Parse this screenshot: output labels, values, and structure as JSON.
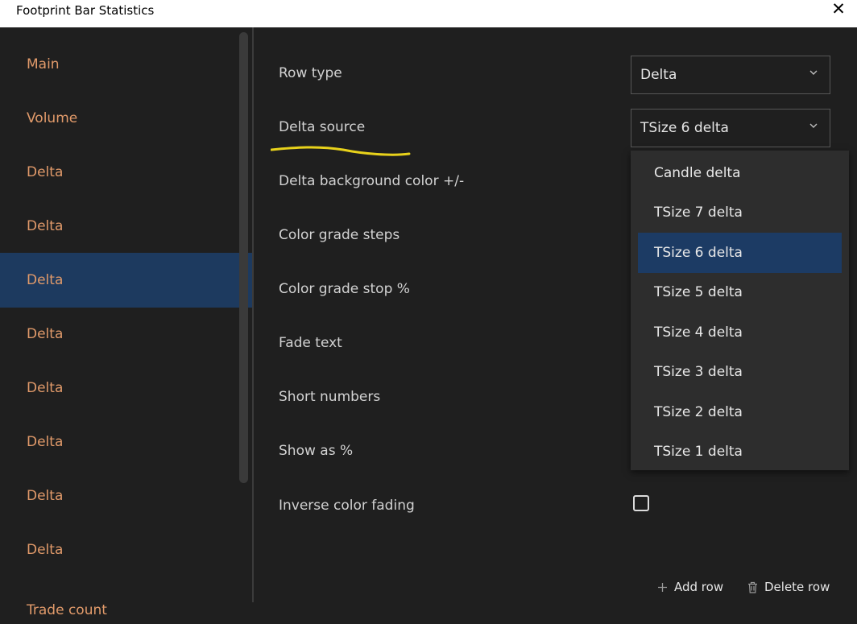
{
  "window": {
    "title": "Footprint Bar Statistics",
    "close_glyph": "✕"
  },
  "sidebar": {
    "items": [
      {
        "label": "Main"
      },
      {
        "label": "Volume"
      },
      {
        "label": "Delta"
      },
      {
        "label": "Delta"
      },
      {
        "label": "Delta",
        "active": true
      },
      {
        "label": "Delta"
      },
      {
        "label": "Delta"
      },
      {
        "label": "Delta"
      },
      {
        "label": "Delta"
      },
      {
        "label": "Delta"
      },
      {
        "label": "Trade count"
      }
    ]
  },
  "settings": {
    "rows": [
      {
        "label": "Row type"
      },
      {
        "label": "Delta source"
      },
      {
        "label": "Delta background color +/-"
      },
      {
        "label": "Color grade steps"
      },
      {
        "label": "Color grade stop %"
      },
      {
        "label": "Fade text"
      },
      {
        "label": "Short numbers"
      },
      {
        "label": "Show as %"
      },
      {
        "label": "Inverse color fading"
      }
    ],
    "row_type_value": "Delta",
    "delta_source_value": "TSize 6 delta",
    "inverse_color_fading_checked": false
  },
  "dropdown": {
    "options": [
      "Candle delta",
      "TSize 7 delta",
      "TSize 6 delta",
      "TSize 5 delta",
      "TSize 4 delta",
      "TSize 3 delta",
      "TSize 2 delta",
      "TSize 1 delta"
    ],
    "selected": "TSize 6 delta"
  },
  "footer": {
    "add_row": "Add row",
    "delete_row": "Delete row"
  },
  "colors": {
    "accent_text": "#e19a6a",
    "selection_bg": "#1d3a5f",
    "highlight_stroke": "#e8d21b",
    "background": "#1f1f1f"
  },
  "icons": {
    "add": "plus-icon",
    "delete": "trash-icon",
    "chevron": "chevron-down-icon",
    "close": "close-icon"
  }
}
